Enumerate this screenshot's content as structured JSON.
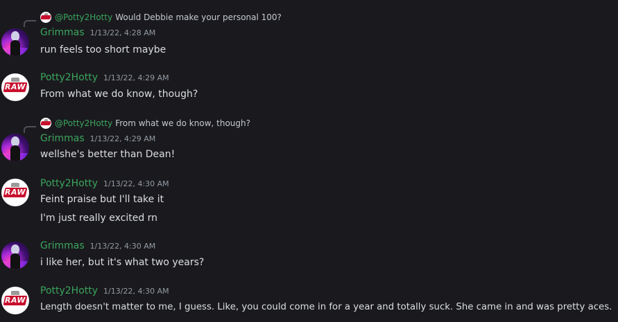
{
  "messages": [
    {
      "reply": {
        "mention": "@Potty2Hotty",
        "text": "Would Debbie make your personal 100?"
      },
      "author": "Grimmas",
      "timestamp": "1/13/22, 4:28 AM",
      "lines": [
        "run feels too short maybe"
      ],
      "avatar": "grimmas-avatar"
    },
    {
      "author": "Potty2Hotty",
      "timestamp": "1/13/22, 4:29 AM",
      "lines": [
        "From what we do know, though?"
      ],
      "avatar": "raw-logo-avatar"
    },
    {
      "reply": {
        "mention": "@Potty2Hotty",
        "text": "From what we do know, though?"
      },
      "author": "Grimmas",
      "timestamp": "1/13/22, 4:29 AM",
      "lines": [
        "wellshe's better than Dean!"
      ],
      "avatar": "grimmas-avatar"
    },
    {
      "author": "Potty2Hotty",
      "timestamp": "1/13/22, 4:30 AM",
      "lines": [
        "Feint praise but I'll take it",
        "I'm just really excited rn"
      ],
      "avatar": "raw-logo-avatar"
    },
    {
      "author": "Grimmas",
      "timestamp": "1/13/22, 4:30 AM",
      "lines": [
        "i like her, but it's what two years?"
      ],
      "avatar": "grimmas-avatar"
    },
    {
      "author": "Potty2Hotty",
      "timestamp": "1/13/22, 4:30 AM",
      "lines": [
        "Length doesn't matter to me, I guess. Like, you could come in for a year and totally suck. She came in and was pretty aces."
      ],
      "avatar": "raw-logo-avatar"
    }
  ],
  "colors": {
    "background": "#1a1a1e",
    "username": "#3ba55d",
    "timestamp": "#949ba4",
    "text": "#dbdee1"
  }
}
